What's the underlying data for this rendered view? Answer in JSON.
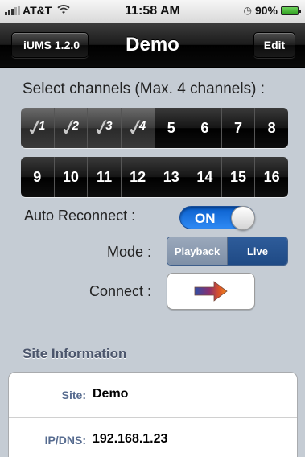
{
  "status_bar": {
    "carrier": "AT&T",
    "time": "11:58 AM",
    "battery_text": "90%",
    "icons": [
      "signal-icon",
      "wifi-icon",
      "alarm-icon",
      "battery-icon"
    ]
  },
  "nav": {
    "back_label": "iUMS 1.2.0",
    "title": "Demo",
    "edit_label": "Edit"
  },
  "channels": {
    "label": "Select channels (Max. 4 channels) :",
    "row1": [
      {
        "label": "1",
        "checked": true
      },
      {
        "label": "2",
        "checked": true
      },
      {
        "label": "3",
        "checked": true
      },
      {
        "label": "4",
        "checked": true
      },
      {
        "label": "5",
        "checked": false
      },
      {
        "label": "6",
        "checked": false
      },
      {
        "label": "7",
        "checked": false
      },
      {
        "label": "8",
        "checked": false
      }
    ],
    "row2": [
      {
        "label": "9",
        "checked": false
      },
      {
        "label": "10",
        "checked": false
      },
      {
        "label": "11",
        "checked": false
      },
      {
        "label": "12",
        "checked": false
      },
      {
        "label": "13",
        "checked": false
      },
      {
        "label": "14",
        "checked": false
      },
      {
        "label": "15",
        "checked": false
      },
      {
        "label": "16",
        "checked": false
      }
    ]
  },
  "auto_reconnect": {
    "label": "Auto Reconnect :",
    "state": "ON"
  },
  "mode": {
    "label": "Mode :",
    "options": [
      "Playback",
      "Live"
    ],
    "selected": "Live"
  },
  "connect": {
    "label": "Connect :",
    "icon": "arrow-right-icon"
  },
  "site_info": {
    "header": "Site Information",
    "rows": [
      {
        "key": "Site:",
        "value": "Demo"
      },
      {
        "key": "IP/DNS:",
        "value": "192.168.1.23"
      }
    ]
  },
  "colors": {
    "background": "#c5ccd4",
    "toggle_on": "#2f8af4",
    "segment_active": "#1f4a85",
    "info_key": "#566b8f"
  }
}
